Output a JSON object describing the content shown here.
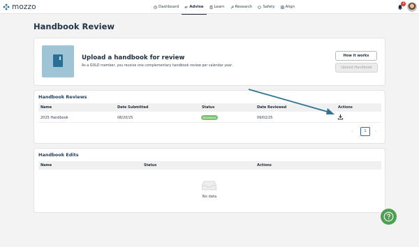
{
  "app": {
    "logo_text": "mozzo"
  },
  "nav": {
    "items": [
      {
        "label": "Dashboard",
        "icon": "clock-icon"
      },
      {
        "label": "Advise",
        "icon": "handshake-icon",
        "active": true
      },
      {
        "label": "Learn",
        "icon": "book-icon"
      },
      {
        "label": "Research",
        "icon": "wrench-icon"
      },
      {
        "label": "Safety",
        "icon": "shield-icon"
      },
      {
        "label": "Align",
        "icon": "grid-icon"
      }
    ]
  },
  "header": {
    "notification_count": "3"
  },
  "page": {
    "title": "Handbook Review"
  },
  "upload": {
    "title": "Upload a handbook for review",
    "subtitle": "As a GOLD member, you receive one complementary handbook review per calendar year.",
    "how_it_works_label": "How it works",
    "upload_label": "Upload Handbook"
  },
  "reviews": {
    "title": "Handbook Reviews",
    "columns": [
      "Name",
      "Date Submitted",
      "Status",
      "Date Reviewed",
      "Actions"
    ],
    "rows": [
      {
        "name": "2025 Handbook",
        "date_submitted": "08/20/25",
        "status": "Reviewed",
        "date_reviewed": "09/02/25"
      }
    ],
    "pagination": {
      "current_page": "1",
      "prev": "‹",
      "next": "›"
    }
  },
  "edits": {
    "title": "Handbook Edits",
    "columns": [
      "Name",
      "Status",
      "Actions"
    ],
    "empty_text": "No data"
  },
  "colors": {
    "accent": "#2a6f95",
    "status_reviewed": "#7cc37a",
    "help_button": "#4e9f52",
    "book_tile": "#9fc4d6"
  }
}
